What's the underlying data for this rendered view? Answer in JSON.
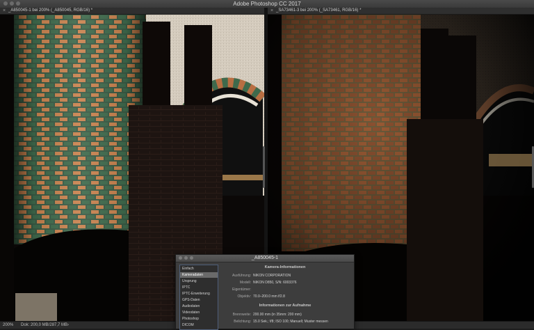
{
  "app": {
    "title": "Adobe Photoshop CC 2017"
  },
  "tabs": [
    {
      "label": "_A850045-1 bei 200% (_A850045, RGB/16) *"
    },
    {
      "label": "_SA73461-3 bei 200% (_SA73461, RGB/16) *"
    }
  ],
  "statusbar": {
    "zoom": "200%",
    "doc": "Dok: 200,0 MB/287,7 MB",
    "arrow": "›"
  },
  "dialog": {
    "title": "_A850045-1",
    "categories": [
      {
        "label": "Einfach",
        "selected": false
      },
      {
        "label": "Kameradaten",
        "selected": true
      },
      {
        "label": "Ursprung",
        "selected": false
      },
      {
        "label": "IPTC",
        "selected": false
      },
      {
        "label": "IPTC-Erweiterung",
        "selected": false
      },
      {
        "label": "GPS-Daten",
        "selected": false
      },
      {
        "label": "Audiodaten",
        "selected": false
      },
      {
        "label": "Videodaten",
        "selected": false
      },
      {
        "label": "Photoshop",
        "selected": false
      },
      {
        "label": "DICOM",
        "selected": false
      }
    ],
    "section1": "Kamera-Informationen",
    "camera_rows": [
      {
        "label": "Ausführung:",
        "value": "NIKON CORPORATION"
      },
      {
        "label": "Modell:",
        "value": "NIKON D850,  S/N: 6003376"
      },
      {
        "label": "Eigentümer:",
        "value": ""
      },
      {
        "label": "Objektiv:",
        "value": "70.0–200.0 mm f/2.8"
      }
    ],
    "section2": "Informationen zur Aufnahme",
    "shot_rows": [
      {
        "label": "Brennweite:",
        "value": "200.00 mm   (in 35mm: 200 mm)"
      },
      {
        "label": "Belichtung:",
        "value": "15.0 Sek.;   f/8;   ISO 100;   Manuell;   Muster messen"
      }
    ]
  },
  "colors": {
    "brick_lit": "#c8824e",
    "tile_green": "#3f6a4c",
    "selection": "#6a6a6a"
  },
  "icons": {
    "tab_close": "×"
  }
}
